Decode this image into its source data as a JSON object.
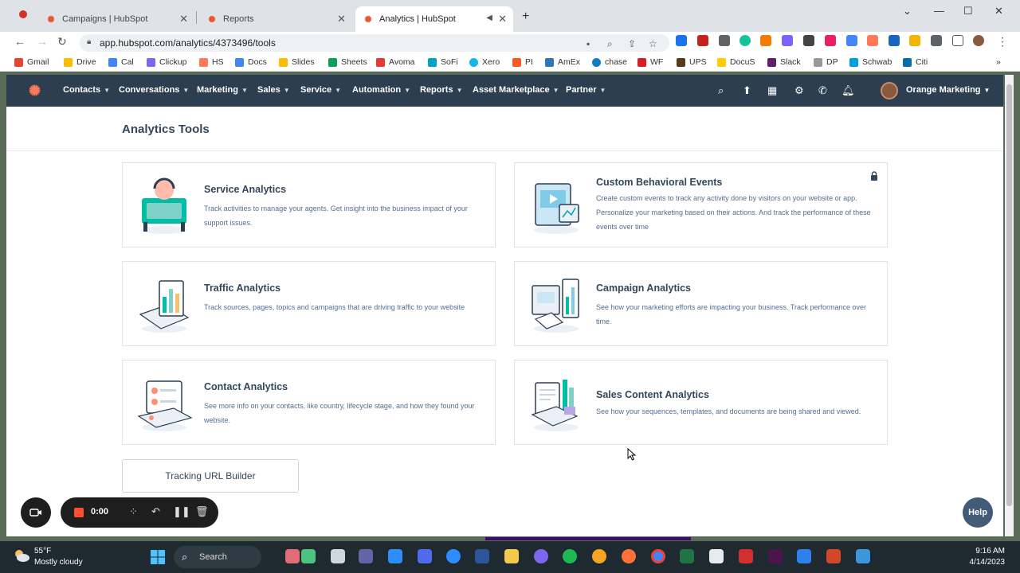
{
  "browser": {
    "tabs": [
      {
        "label": "Campaigns | HubSpot",
        "active": false
      },
      {
        "label": "Reports",
        "active": false
      },
      {
        "label": "Analytics | HubSpot",
        "active": true
      }
    ],
    "url": "app.hubspot.com/analytics/4373496/tools",
    "bookmarks": [
      "Gmail",
      "Drive",
      "Cal",
      "Clickup",
      "HS",
      "Docs",
      "Slides",
      "Sheets",
      "Avoma",
      "SoFi",
      "Xero",
      "PI",
      "AmEx",
      "chase",
      "WF",
      "UPS",
      "DocuS",
      "Slack",
      "DP",
      "Schwab",
      "Citi"
    ]
  },
  "hubspot_nav": {
    "items": [
      {
        "label": "Contacts"
      },
      {
        "label": "Conversations"
      },
      {
        "label": "Marketing"
      },
      {
        "label": "Sales"
      },
      {
        "label": "Service"
      },
      {
        "label": "Automation"
      },
      {
        "label": "Reports"
      },
      {
        "label": "Asset Marketplace"
      },
      {
        "label": "Partner"
      }
    ],
    "account": "Orange Marketing"
  },
  "page": {
    "title": "Analytics Tools",
    "cards": [
      {
        "title": "Service Analytics",
        "description": "Track activities to manage your agents. Get insight into the business impact of your support issues.",
        "icon": "service-illustration"
      },
      {
        "title": "Custom Behavioral Events",
        "description": "Create custom events to track any activity done by visitors on your website or app. Personalize your marketing based on their actions. And track the performance of these events over time",
        "icon": "behavioral-events-illustration",
        "locked": true
      },
      {
        "title": "Traffic Analytics",
        "description": "Track sources, pages, topics and campaigns that are driving traffic to your website",
        "icon": "traffic-illustration"
      },
      {
        "title": "Campaign Analytics",
        "description": "See how your marketing efforts are impacting your business. Track performance over time.",
        "icon": "campaign-illustration"
      },
      {
        "title": "Contact Analytics",
        "description": "See more info on your contacts, like country, lifecycle stage, and how they found your website.",
        "icon": "contact-illustration"
      },
      {
        "title": "Sales Content Analytics",
        "description": "See how your sequences, templates, and documents are being shared and viewed.",
        "icon": "sales-content-illustration"
      }
    ],
    "tracking_button": "Tracking URL Builder",
    "help_button": "Help"
  },
  "recorder": {
    "time": "0:00"
  },
  "taskbar": {
    "temperature": "55°F",
    "weather": "Mostly cloudy",
    "search": "Search",
    "time": "9:16 AM",
    "date": "4/14/2023"
  },
  "colors": {
    "nav_bg": "#2d3e50",
    "accent": "#ff7a59",
    "title_text": "#33475b",
    "desc_text": "#516f90"
  }
}
